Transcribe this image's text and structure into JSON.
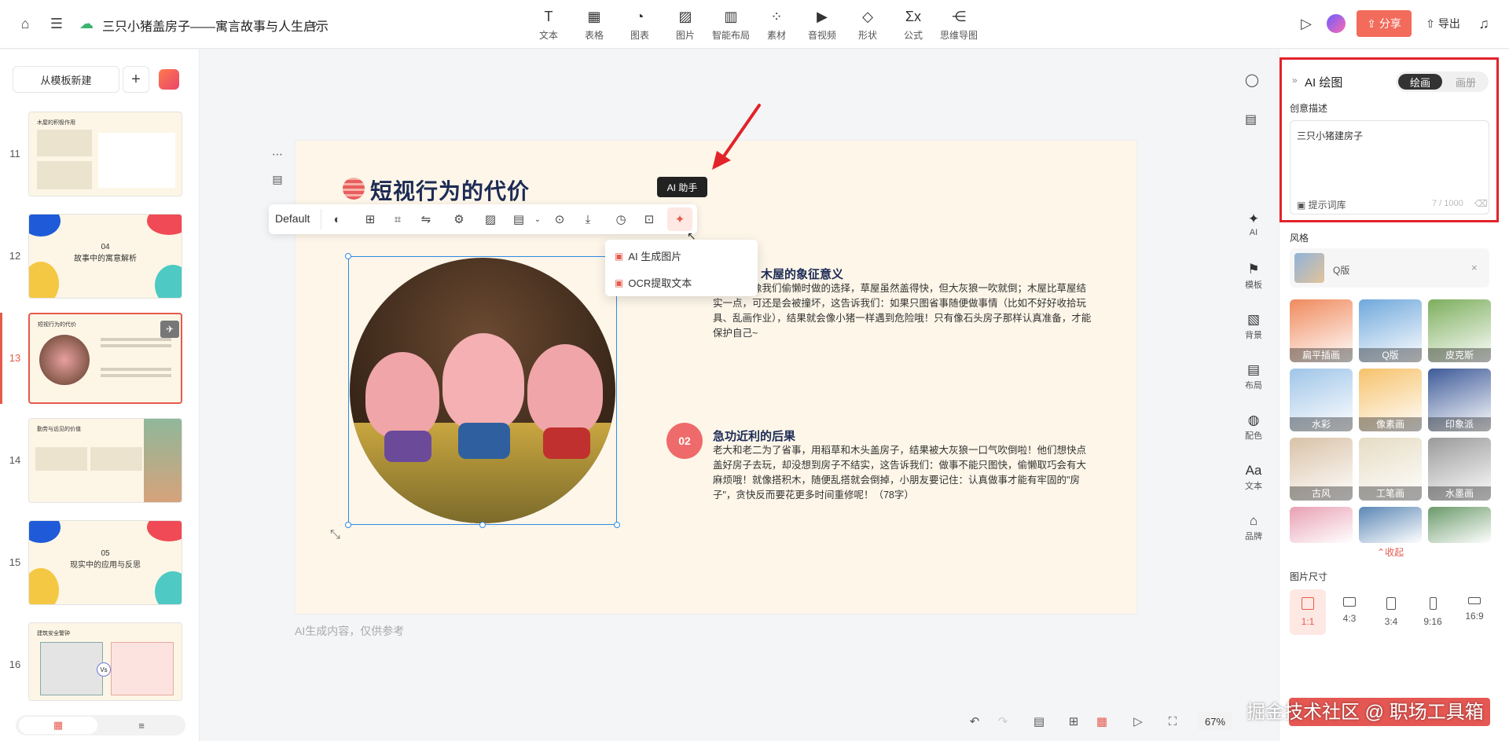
{
  "topbar": {
    "doc_title": "三只小猪盖房子——寓言故事与人生启示",
    "tools": [
      {
        "label": "文本",
        "icon": "T"
      },
      {
        "label": "表格",
        "icon": "▦"
      },
      {
        "label": "图表",
        "icon": "◔"
      },
      {
        "label": "图片",
        "icon": "▨"
      },
      {
        "label": "智能布局",
        "icon": "▥"
      },
      {
        "label": "素材",
        "icon": "⁘"
      },
      {
        "label": "音视频",
        "icon": "▶"
      },
      {
        "label": "形状",
        "icon": "◇"
      },
      {
        "label": "公式",
        "icon": "Σx"
      },
      {
        "label": "思维导图",
        "icon": "⋲"
      }
    ],
    "share_label": "分享",
    "export_label": "导出"
  },
  "leftpanel": {
    "new_from_template": "从模板新建",
    "slides": [
      {
        "num": "11",
        "title": "木屋的积极作用",
        "center": ""
      },
      {
        "num": "12",
        "title": "",
        "center": "04\n故事中的寓意解析"
      },
      {
        "num": "13",
        "title": "短视行为的代价",
        "center": ""
      },
      {
        "num": "14",
        "title": "勤劳与远见的价值",
        "center": ""
      },
      {
        "num": "15",
        "title": "",
        "center": "05\n现实中的应用与反思"
      },
      {
        "num": "16",
        "title": "建筑安全警钟",
        "center": ""
      }
    ]
  },
  "slide": {
    "title": "短视行为的代价",
    "section1_heading": "木屋的象征意义",
    "section1_text": "像二哥就像我们偷懒时做的选择，草屋虽然盖得快，但大灰狼一吹就倒；木屋比草屋结实一点，可还是会被撞坏，这告诉我们：如果只图省事随便做事情（比如不好好收拾玩具、乱画作业），结果就会像小猪一样遇到危险哦！只有像石头房子那样认真准备，才能保护自己~",
    "badge": "02",
    "section2_heading": "急功近利的后果",
    "section2_text": "老大和老二为了省事，用稻草和木头盖房子，结果被大灰狼一口气吹倒啦！他们想快点盖好房子去玩，却没想到房子不结实，这告诉我们：做事不能只图快，偷懒取巧会有大麻烦哦！就像搭积木，随便乱搭就会倒掉，小朋友要记住：认真做事才能有牢固的\"房子\"，贪快反而要花更多时间重修呢！（78字）",
    "ai_note": "AI生成内容，仅供参考"
  },
  "img_toolbar": {
    "style_label": "Default",
    "tooltip": "AI 助手",
    "menu": [
      "AI 生成图片",
      "OCR提取文本"
    ]
  },
  "side_tools": [
    {
      "label": "AI",
      "icon": "✦"
    },
    {
      "label": "模板",
      "icon": "⚑"
    },
    {
      "label": "背景",
      "icon": "▧"
    },
    {
      "label": "布局",
      "icon": "▤"
    },
    {
      "label": "配色",
      "icon": "◍"
    },
    {
      "label": "文本",
      "icon": "Aa"
    },
    {
      "label": "品牌",
      "icon": "⌂"
    }
  ],
  "ai_panel": {
    "title": "AI 绘图",
    "mode_draw": "绘画",
    "mode_album": "画册",
    "desc_label": "创意描述",
    "prompt": "三只小猪建房子",
    "prompt_lib": "提示词库",
    "prompt_count": "7 / 1000",
    "style_label": "风格",
    "style_selected": "Q版",
    "styles": [
      {
        "label": "扁平插画",
        "color": "#f08a5d"
      },
      {
        "label": "Q版",
        "color": "#6fa8dc"
      },
      {
        "label": "皮克斯",
        "color": "#7cae5c"
      },
      {
        "label": "水彩",
        "color": "#9fc5e8"
      },
      {
        "label": "像素画",
        "color": "#f6c26b"
      },
      {
        "label": "印象派",
        "color": "#3d5a98"
      },
      {
        "label": "古风",
        "color": "#d9c2a7"
      },
      {
        "label": "工笔画",
        "color": "#e6dcc3"
      },
      {
        "label": "水墨画",
        "color": "#9a9a9a"
      },
      {
        "label": "",
        "color": "#e8a0b4"
      },
      {
        "label": "",
        "color": "#5b87b5"
      },
      {
        "label": "",
        "color": "#6a9a6a"
      }
    ],
    "collapse": "收起",
    "size_label": "图片尺寸",
    "sizes": [
      "1:1",
      "4:3",
      "3:4",
      "9:16",
      "16:9"
    ]
  },
  "bottom": {
    "zoom": "67%",
    "watermark": "掘金技术社区 @ 职场工具箱"
  }
}
